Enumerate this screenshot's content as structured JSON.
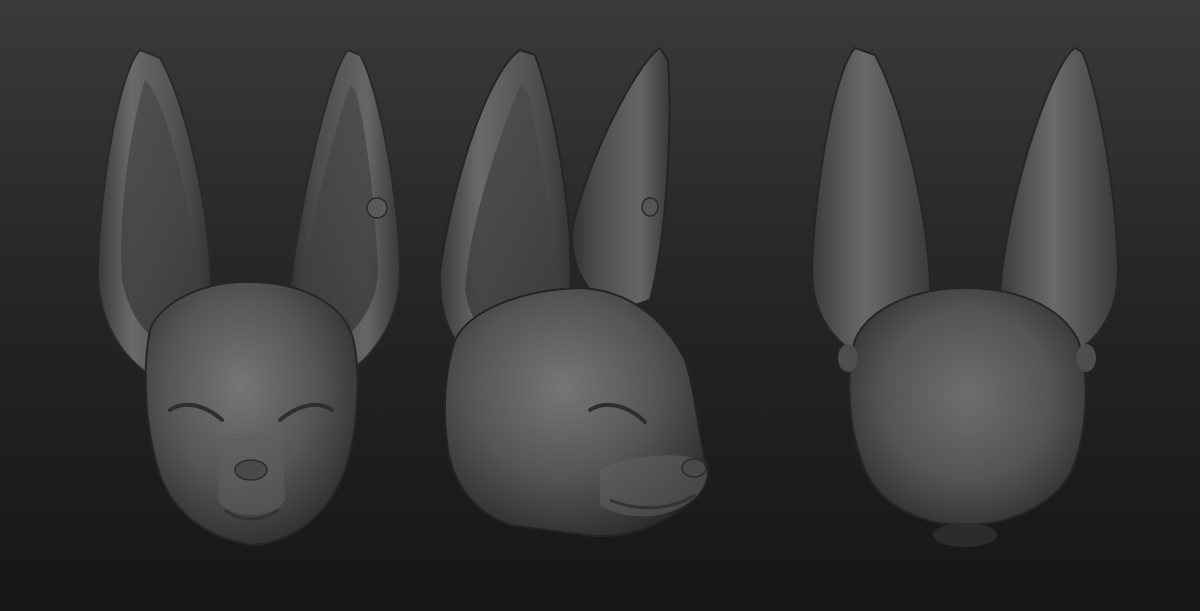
{
  "scene": {
    "background_top": "#3a3a3a",
    "background_bottom": "#161616",
    "clay_color": "#555555",
    "clay_highlight": "#747474",
    "clay_shadow": "#2a2a2a"
  },
  "views": [
    {
      "name": "front-view"
    },
    {
      "name": "three-quarter-view"
    },
    {
      "name": "back-view"
    }
  ]
}
